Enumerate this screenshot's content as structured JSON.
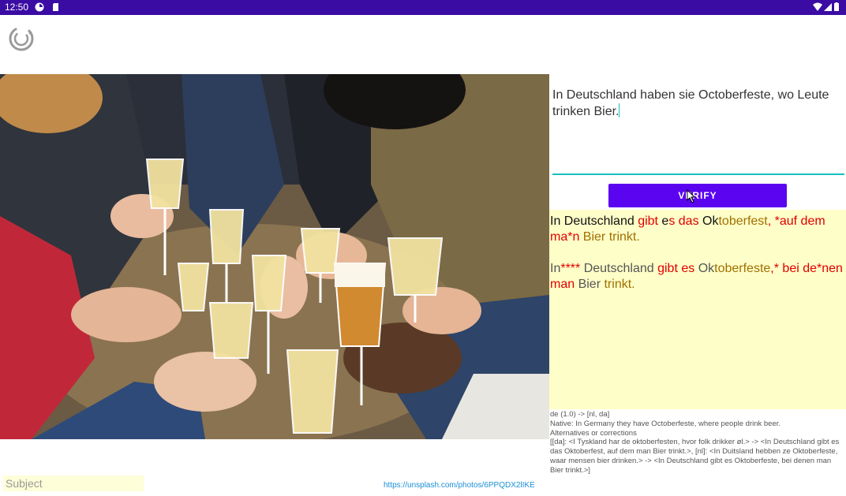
{
  "status_bar": {
    "time": "12:50"
  },
  "sentence": {
    "text": "In Deutschland haben sie Octoberfeste, wo Leute trinken Bier."
  },
  "verify": {
    "label": "VERIFY"
  },
  "results": [
    [
      {
        "t": "In Deutschland ",
        "c": "black"
      },
      {
        "t": "gibt",
        "c": "red"
      },
      {
        "t": " e",
        "c": "black"
      },
      {
        "t": "s das ",
        "c": "red"
      },
      {
        "t": "Ok",
        "c": "black"
      },
      {
        "t": "toberfest",
        "c": "brown"
      },
      {
        "t": ", *auf dem ma*n ",
        "c": "red"
      },
      {
        "t": "Bier trinkt.",
        "c": "brown"
      }
    ],
    [
      {
        "t": "In",
        "c": "gray"
      },
      {
        "t": "**** ",
        "c": "red"
      },
      {
        "t": "Deutschland ",
        "c": "gray"
      },
      {
        "t": "gibt es ",
        "c": "red"
      },
      {
        "t": "Ok",
        "c": "gray"
      },
      {
        "t": "toberfeste",
        "c": "brown"
      },
      {
        "t": ",* bei de*nen man ",
        "c": "red"
      },
      {
        "t": "Bier ",
        "c": "gray"
      },
      {
        "t": "trinkt.",
        "c": "brown"
      }
    ]
  ],
  "info": {
    "lines": [
      "de (1.0) -> [nl, da]",
      "Native: In Germany they have Octoberfeste, where people drink beer.",
      "Alternatives or corrections",
      "[[da]: <I Tyskland har de oktoberfesten, hvor folk drikker øl.> -> <In Deutschland gibt es das Oktoberfest, auf dem man Bier trinkt.>, [nl]: <In Duitsland hebben ze Oktoberfeste, waar mensen bier drinken.> -> <In Deutschland gibt es Oktoberfeste, bei denen man Bier trinkt.>]"
    ]
  },
  "subject": {
    "placeholder": "Subject"
  },
  "credit": {
    "text": "https://unsplash.com/photos/6PPQDX2lIKE"
  },
  "colors": {
    "status_bar": "#3a0ca3",
    "button": "#5b04f0",
    "accent": "#17c0c0",
    "result_bg": "#fefec8",
    "red": "#e00000",
    "brown": "#a07000"
  }
}
